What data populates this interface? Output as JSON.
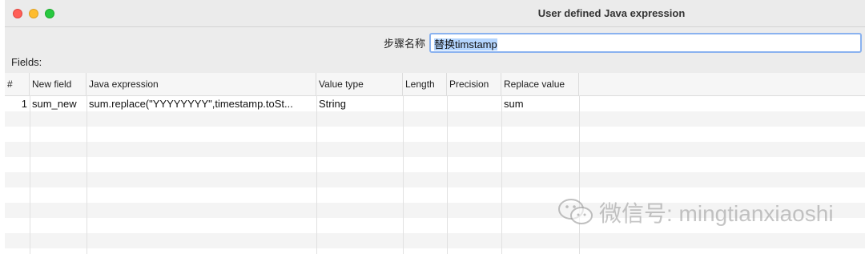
{
  "window": {
    "title": "User defined Java expression"
  },
  "step": {
    "label": "步骤名称",
    "value": "替换timstamp"
  },
  "fields": {
    "label": "Fields:",
    "columns": [
      "#",
      "New field",
      "Java expression",
      "Value type",
      "Length",
      "Precision",
      "Replace value"
    ],
    "rows": [
      {
        "num": "1",
        "new_field": "sum_new",
        "java_expression": "sum.replace(\"YYYYYYYY\",timestamp.toSt...",
        "value_type": "String",
        "length": "",
        "precision": "",
        "replace_value": "sum"
      }
    ]
  },
  "watermark": {
    "text": "微信号: mingtianxiaoshi",
    "icon": "wechat-icon"
  },
  "colors": {
    "close": "#ff5f57",
    "minimize": "#febc2e",
    "maximize": "#28c840",
    "input_focus": "#8ab2ef",
    "selection": "#b4d5fe"
  }
}
